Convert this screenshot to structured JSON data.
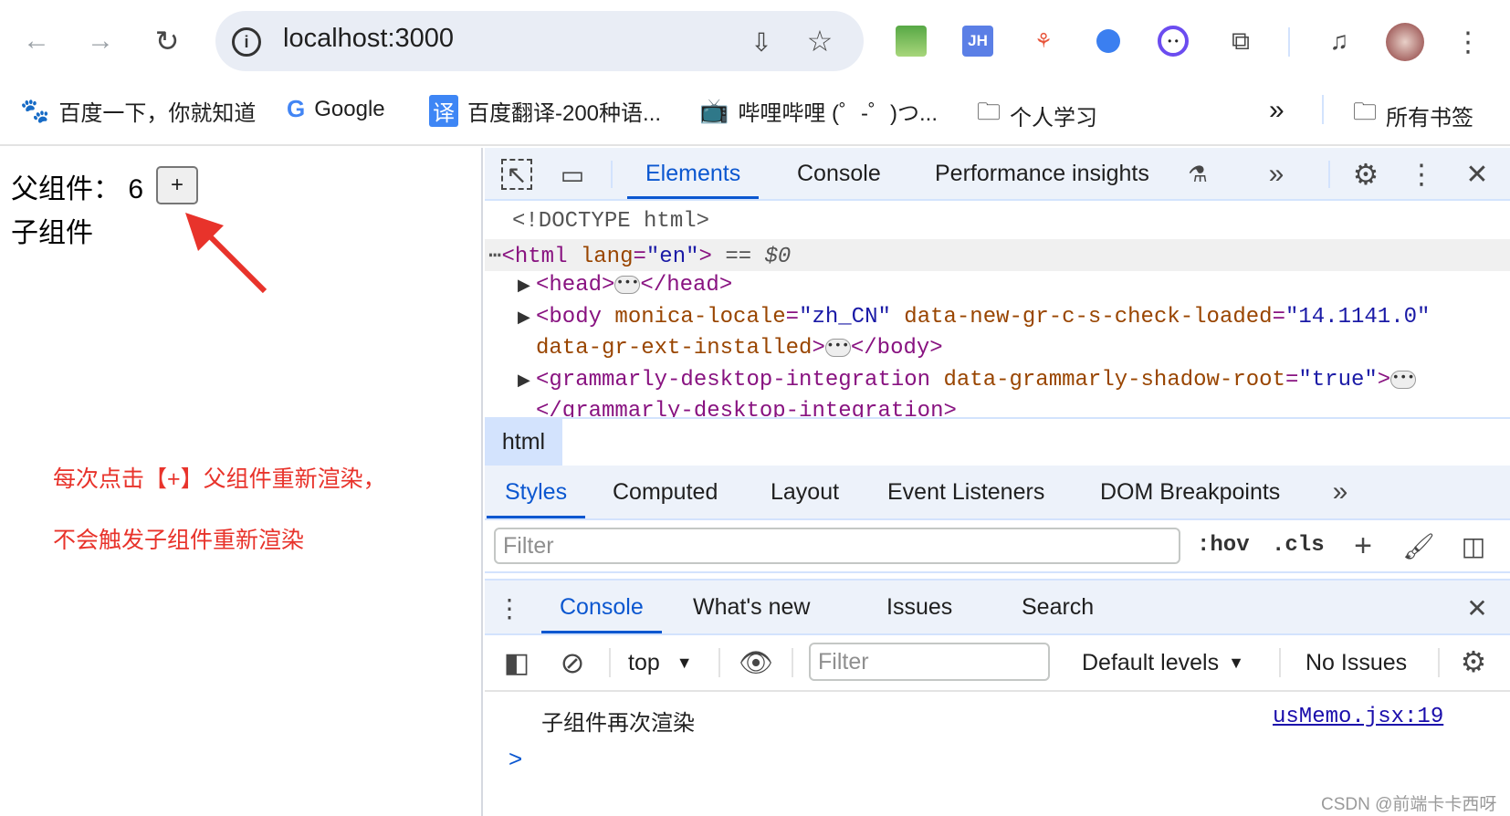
{
  "browser": {
    "url": "localhost:3000",
    "bookmarks": [
      {
        "label": "百度一下，你就知道",
        "icon": "baidu-paw-icon"
      },
      {
        "label": "Google",
        "icon": "google-g-icon"
      },
      {
        "label": "百度翻译-200种语...",
        "icon": "translate-icon"
      },
      {
        "label": "哔哩哔哩 (゜-゜)つ...",
        "icon": "bilibili-icon"
      },
      {
        "label": "个人学习",
        "icon": "folder-icon"
      }
    ],
    "more": "»",
    "all_bookmarks": "所有书签"
  },
  "page": {
    "parent_label": "父组件：",
    "count": "6",
    "plus_button": "+",
    "child_label": "子组件",
    "note_line1": "每次点击【+】父组件重新渲染，",
    "note_line2": "不会触发子组件重新渲染",
    "note_color": "#e8332b"
  },
  "devtools": {
    "tabs": [
      "Elements",
      "Console",
      "Performance insights"
    ],
    "dom": {
      "doctype": "<!DOCTYPE html>",
      "html_open": "<html",
      "html_attr": "lang",
      "html_val": "\"en\"",
      "sel": "== $0",
      "head": "<head>",
      "head_close": "</head>",
      "body_tag": "<body",
      "body_a1": "monica-locale",
      "body_v1": "\"zh_CN\"",
      "body_a2": "data-new-gr-c-s-check-loaded",
      "body_v2": "\"14.1141.0\"",
      "body_a3": "data-gr-ext-installed",
      "body_close": "</body>",
      "gr_tag": "<grammarly-desktop-integration",
      "gr_attr": "data-grammarly-shadow-root",
      "gr_val": "\"true\"",
      "gr_close": "</grammarly-desktop-integration>"
    },
    "breadcrumb": "html",
    "style_tabs": [
      "Styles",
      "Computed",
      "Layout",
      "Event Listeners",
      "DOM Breakpoints"
    ],
    "filter_placeholder": "Filter",
    "hov": ":hov",
    "cls": ".cls",
    "drawer_tabs": [
      "Console",
      "What's new",
      "Issues",
      "Search"
    ],
    "context": "top",
    "console_filter_placeholder": "Filter",
    "levels": "Default levels",
    "issues": "No Issues",
    "message": "子组件再次渲染",
    "source": "usMemo.jsx:19",
    "prompt": ">"
  },
  "watermark": "CSDN @前端卡卡西呀"
}
